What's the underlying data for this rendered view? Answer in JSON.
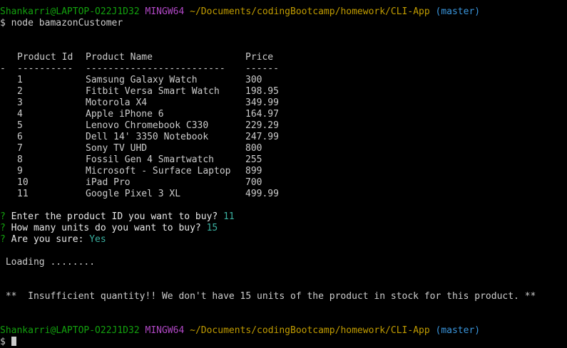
{
  "prompt": {
    "user": "Shankarri@LAPTOP-O22J1D32",
    "shell": "MINGW64",
    "path": "~/Documents/codingBootcamp/homework/CLI-App",
    "branch": "(master)",
    "symbol": "$"
  },
  "command": "node bamazonCustomer",
  "table": {
    "headers": [
      "Product Id",
      "Product Name",
      "Price"
    ],
    "separator": {
      "lead": "-",
      "id": "----------",
      "name": "-------------------------",
      "price": "------"
    },
    "rows": [
      {
        "id": "1",
        "name": "Samsung Galaxy Watch",
        "price": "300"
      },
      {
        "id": "2",
        "name": "Fitbit Versa Smart Watch",
        "price": "198.95"
      },
      {
        "id": "3",
        "name": "Motorola X4",
        "price": "349.99"
      },
      {
        "id": "4",
        "name": "Apple iPhone 6",
        "price": "164.97"
      },
      {
        "id": "5",
        "name": "Lenovo Chromebook C330",
        "price": "229.29"
      },
      {
        "id": "6",
        "name": "Dell 14' 3350 Notebook",
        "price": "247.99"
      },
      {
        "id": "7",
        "name": "Sony TV UHD",
        "price": "800"
      },
      {
        "id": "8",
        "name": "Fossil Gen 4 Smartwatch",
        "price": "255"
      },
      {
        "id": "9",
        "name": "Microsoft - Surface Laptop",
        "price": "899"
      },
      {
        "id": "10",
        "name": "iPad Pro",
        "price": "700"
      },
      {
        "id": "11",
        "name": "Google Pixel 3 XL",
        "price": "499.99"
      }
    ]
  },
  "questions": [
    {
      "mark": "?",
      "text": "Enter the product ID you want to buy?",
      "answer": "11"
    },
    {
      "mark": "?",
      "text": "How many units do you want to buy?",
      "answer": "15"
    },
    {
      "mark": "?",
      "text": "Are you sure:",
      "answer": "Yes"
    }
  ],
  "loading": "Loading ........",
  "message": "**  Insufficient quantity!! We don't have 15 units of the product in stock for this product. **",
  "colors": {
    "background": "#000000",
    "foreground": "#cccccc",
    "user": "#13a10e",
    "shell": "#b148c6",
    "path": "#c19c00",
    "branch": "#3a96dd",
    "answer": "#3ab0a0"
  }
}
